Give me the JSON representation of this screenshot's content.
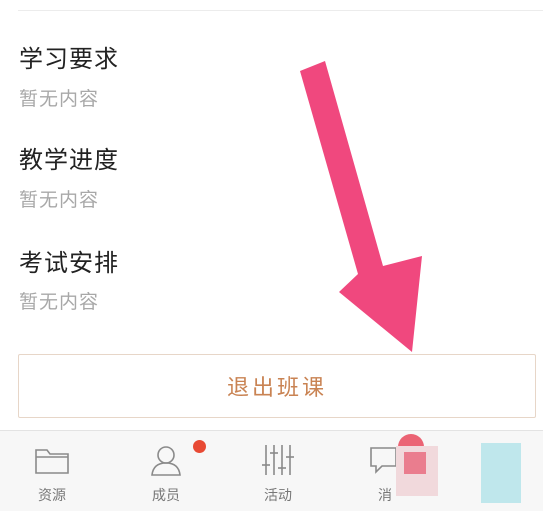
{
  "sections": [
    {
      "title": "学习要求",
      "content": "暂无内容"
    },
    {
      "title": "教学进度",
      "content": "暂无内容"
    },
    {
      "title": "考试安排",
      "content": "暂无内容"
    }
  ],
  "quit_button": {
    "label": "退出班课"
  },
  "tabbar": {
    "items": [
      {
        "label": "资源",
        "icon": "folder-icon"
      },
      {
        "label": "成员",
        "icon": "person-icon",
        "badge": true
      },
      {
        "label": "活动",
        "icon": "sliders-icon"
      },
      {
        "label": "消",
        "icon": "message-icon",
        "badge": true
      },
      {
        "label": "",
        "icon": "document-icon"
      }
    ]
  },
  "colors": {
    "accent": "#c98353",
    "badge": "#e84a34",
    "arrow": "#f0487e"
  }
}
